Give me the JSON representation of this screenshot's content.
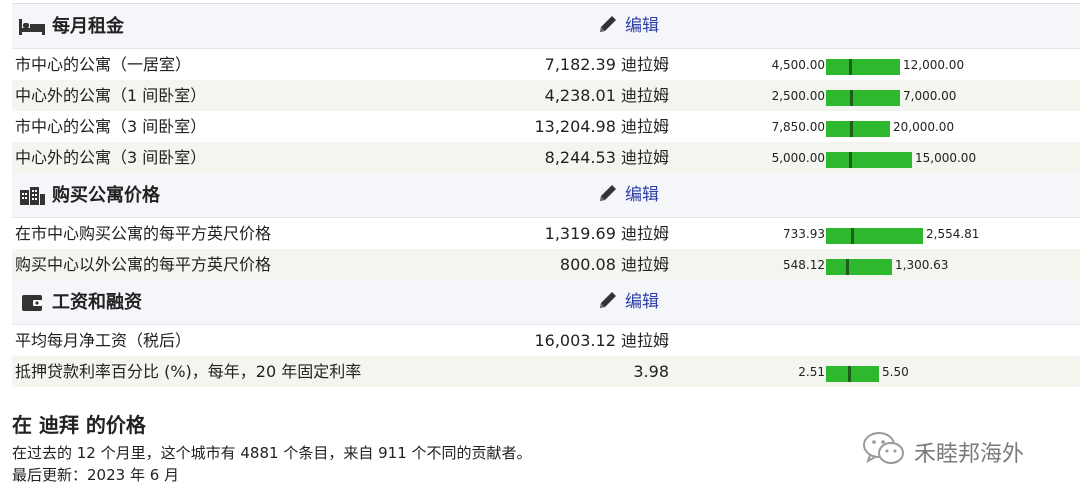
{
  "sections": [
    {
      "title": "每月租金",
      "icon": "bed-icon",
      "edit_label": "编辑",
      "rows": [
        {
          "name": "市中心的公寓（一居室）",
          "price": "7,182.39 迪拉姆",
          "min": "4,500.00",
          "max": "12,000.00",
          "min_value": 4500,
          "max_value": 12000,
          "value": 7182.39
        },
        {
          "name": "中心外的公寓（1 间卧室）",
          "price": "4,238.01 迪拉姆",
          "min": "2,500.00",
          "max": "7,000.00",
          "min_value": 2500,
          "max_value": 7000,
          "value": 4238.01
        },
        {
          "name": "市中心的公寓（3 间卧室）",
          "price": "13,204.98 迪拉姆",
          "min": "7,850.00",
          "max": "20,000.00",
          "min_value": 7850,
          "max_value": 20000,
          "value": 13204.98
        },
        {
          "name": "中心外的公寓（3 间卧室）",
          "price": "8,244.53 迪拉姆",
          "min": "5,000.00",
          "max": "15,000.00",
          "min_value": 5000,
          "max_value": 15000,
          "value": 8244.53
        }
      ]
    },
    {
      "title": "购买公寓价格",
      "icon": "building-icon",
      "edit_label": "编辑",
      "rows": [
        {
          "name": "在市中心购买公寓的每平方英尺价格",
          "price": "1,319.69 迪拉姆",
          "min": "733.93",
          "max": "2,554.81",
          "min_value": 733.93,
          "max_value": 2554.81,
          "value": 1319.69
        },
        {
          "name": "购买中心以外公寓的每平方英尺价格",
          "price": "800.08 迪拉姆",
          "min": "548.12",
          "max": "1,300.63",
          "min_value": 548.12,
          "max_value": 1300.63,
          "value": 800.08
        }
      ]
    },
    {
      "title": "工资和融资",
      "icon": "wallet-icon",
      "edit_label": "编辑",
      "rows": [
        {
          "name": "平均每月净工资（税后）",
          "price": "16,003.12 迪拉姆",
          "min": "",
          "max": ""
        },
        {
          "name": "抵押贷款利率百分比 (%)，每年，20 年固定利率",
          "price": "3.98",
          "min": "2.51",
          "max": "5.50",
          "min_value": 2.51,
          "max_value": 5.5,
          "value": 3.98
        }
      ]
    }
  ],
  "footer": {
    "title": "在 迪拜 的价格",
    "line1": "在过去的 12 个月里，这个城市有 4881 个条目，来自 911 个不同的贡献者。",
    "line2": "最后更新：2023 年 6 月"
  },
  "watermark": {
    "text": "禾睦邦海外",
    "icon": "wechat-icon"
  },
  "colors": {
    "bar": "#2db82d",
    "bar_marker": "#1b5e1b",
    "edit_link": "#2f3fa8",
    "header_bg": "#f4f6f9",
    "alt_row_bg": "#f3f5ef"
  }
}
